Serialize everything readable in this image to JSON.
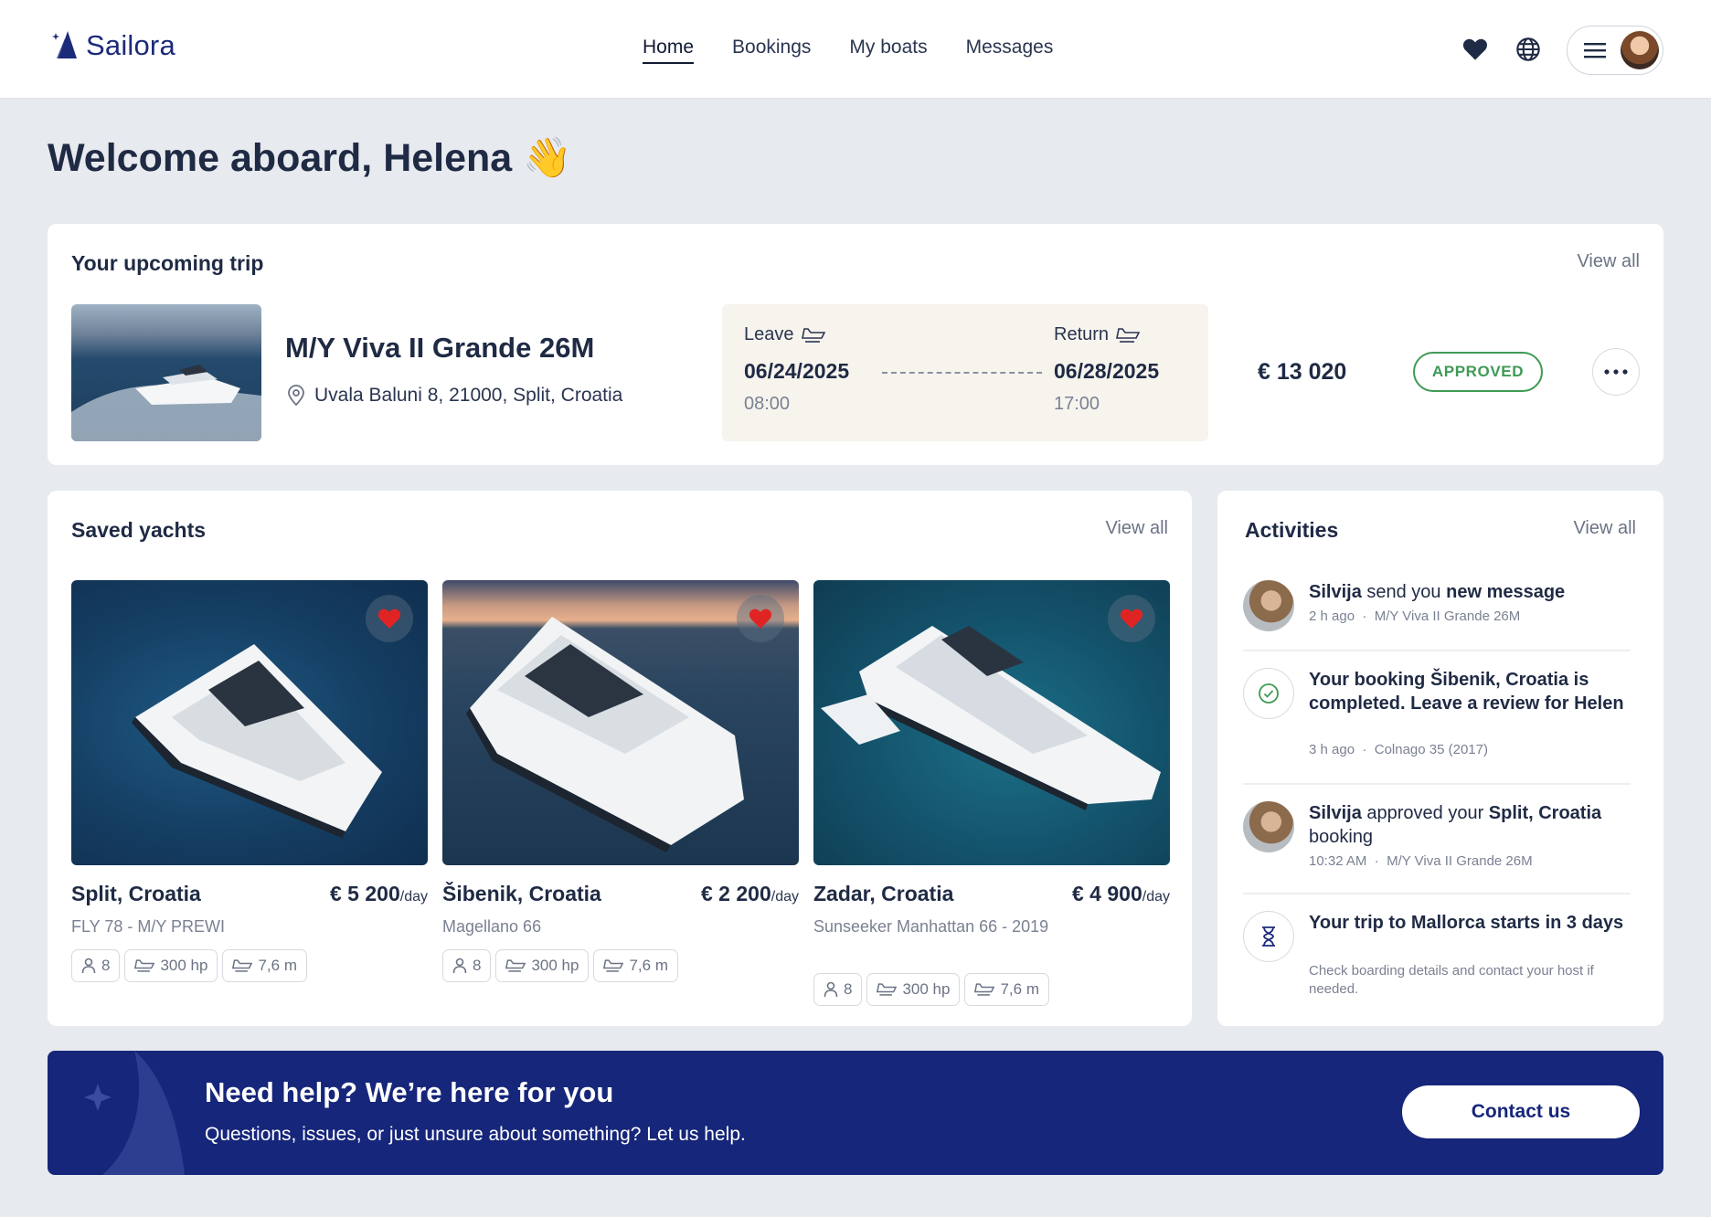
{
  "app": {
    "name": "Sailora"
  },
  "nav": {
    "items": [
      {
        "label": "Home",
        "active": true
      },
      {
        "label": "Bookings",
        "active": false
      },
      {
        "label": "My boats",
        "active": false
      },
      {
        "label": "Messages",
        "active": false
      }
    ]
  },
  "header_icons": [
    "heart-icon",
    "globe-icon",
    "menu-icon",
    "avatar"
  ],
  "welcome": {
    "title": "Welcome aboard, Helena",
    "emoji": "👋"
  },
  "upcoming_trip": {
    "section_title": "Your upcoming trip",
    "view_all": "View all",
    "boat_name": "M/Y Viva II Grande 26M",
    "address": "Uvala Baluni 8, 21000, Split, Croatia",
    "leave_label": "Leave",
    "leave_date": "06/24/2025",
    "leave_time": "08:00",
    "return_label": "Return",
    "return_date": "06/28/2025",
    "return_time": "17:00",
    "price": "€ 13 020",
    "status": "APPROVED",
    "status_color": "#3f9a56"
  },
  "saved": {
    "section_title": "Saved yachts",
    "view_all": "View all",
    "per_day": "/day",
    "items": [
      {
        "location": "Split, Croatia",
        "price": "€ 5 200",
        "model": "FLY 78 - M/Y PREWI",
        "guests": "8",
        "power": "300 hp",
        "length": "7,6 m"
      },
      {
        "location": "Šibenik, Croatia",
        "price": "€ 2 200",
        "model": "Magellano 66",
        "guests": "8",
        "power": "300 hp",
        "length": "7,6 m"
      },
      {
        "location": "Zadar, Croatia",
        "price": "€ 4 900",
        "model": "Sunseeker Manhattan 66 - 2019",
        "guests": "8",
        "power": "300 hp",
        "length": "7,6 m"
      }
    ]
  },
  "activities": {
    "section_title": "Activities",
    "view_all": "View all",
    "items": [
      {
        "icon": "avatar",
        "parts": [
          "Silvija",
          " send you ",
          "new message"
        ],
        "time": "2 h ago",
        "sep": "·",
        "ref": "M/Y Viva II Grande 26M"
      },
      {
        "icon": "check-circle-icon",
        "text": "Your booking  Šibenik, Croatia is completed. Leave a review for Helen",
        "time": "3 h ago",
        "sep": "·",
        "ref": "Colnago 35 (2017)"
      },
      {
        "icon": "avatar",
        "parts": [
          "Silvija",
          " approved your ",
          "Split, Croatia",
          " booking"
        ],
        "time": "10:32 AM",
        "sep": "·",
        "ref": "M/Y Viva II Grande 26M"
      },
      {
        "icon": "hourglass-icon",
        "text": "Your trip to Mallorca starts in 3 days",
        "desc": "Check boarding details and contact your host if needed."
      }
    ]
  },
  "help": {
    "title": "Need help? We’re here for you",
    "subtitle": "Questions, issues, or just unsure about something? Let us help.",
    "button": "Contact us"
  },
  "colors": {
    "brand": "#16267a",
    "approved": "#3f9a56",
    "heart": "#e02424",
    "background": "#e7eaee"
  }
}
